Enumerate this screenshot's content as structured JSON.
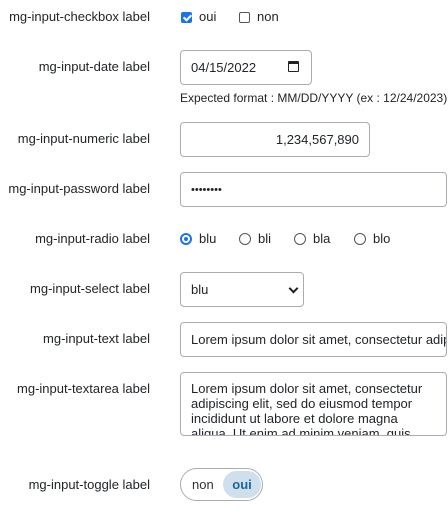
{
  "checkbox": {
    "label": "mg-input-checkbox label",
    "options": [
      {
        "label": "oui",
        "checked": true
      },
      {
        "label": "non",
        "checked": false
      }
    ]
  },
  "date": {
    "label": "mg-input-date label",
    "value": "04/15/2022",
    "hint": "Expected format : MM/DD/YYYY (ex : 12/24/2023)"
  },
  "numeric": {
    "label": "mg-input-numeric label",
    "value": "1,234,567,890"
  },
  "password": {
    "label": "mg-input-password label",
    "value": "••••••••"
  },
  "radio": {
    "label": "mg-input-radio label",
    "options": [
      {
        "label": "blu",
        "checked": true
      },
      {
        "label": "bli",
        "checked": false
      },
      {
        "label": "bla",
        "checked": false
      },
      {
        "label": "blo",
        "checked": false
      }
    ]
  },
  "select": {
    "label": "mg-input-select label",
    "value": "blu"
  },
  "text": {
    "label": "mg-input-text label",
    "value": "Lorem ipsum dolor sit amet, consectetur adipiscing elit"
  },
  "textarea": {
    "label": "mg-input-textarea label",
    "value": "Lorem ipsum dolor sit amet, consectetur adipiscing elit, sed do eiusmod tempor incididunt ut labore et dolore magna aliqua. Ut enim ad minim veniam, quis nostrud exercitation"
  },
  "toggle": {
    "label": "mg-input-toggle label",
    "off_label": "non",
    "on_label": "oui",
    "value": "oui"
  },
  "colors": {
    "accent": "#1a73e8",
    "border": "#a9adb3",
    "toggle_active_bg": "#cfe0ec",
    "toggle_active_text": "#1565a7"
  }
}
